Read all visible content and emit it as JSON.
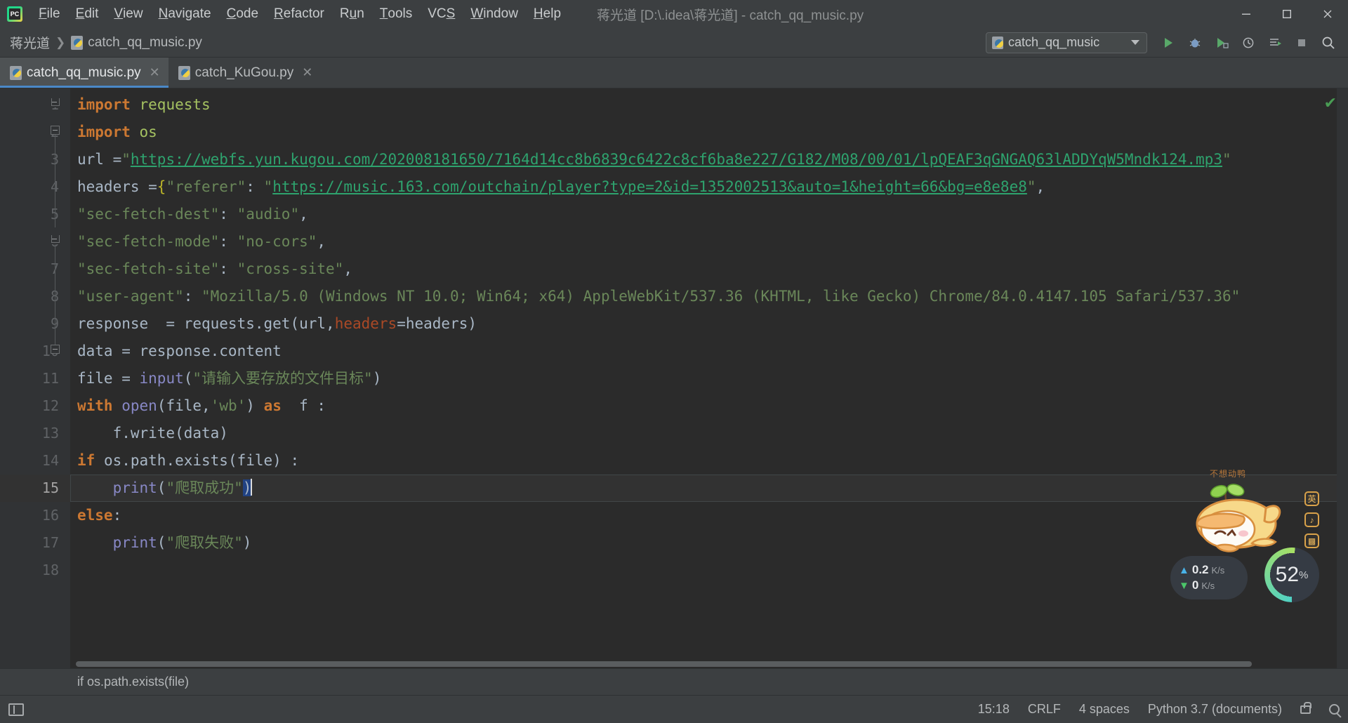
{
  "window": {
    "app_icon": "pycharm-logo-icon",
    "title": "蒋光道 [D:\\.idea\\蒋光道] - catch_qq_music.py",
    "controls": {
      "minimize": "−",
      "maximize": "▢",
      "close": "✕"
    }
  },
  "menubar": [
    {
      "label": "File",
      "mnemonic": "F"
    },
    {
      "label": "Edit",
      "mnemonic": "E"
    },
    {
      "label": "View",
      "mnemonic": "V"
    },
    {
      "label": "Navigate",
      "mnemonic": "N"
    },
    {
      "label": "Code",
      "mnemonic": "C"
    },
    {
      "label": "Refactor",
      "mnemonic": "R"
    },
    {
      "label": "Run",
      "mnemonic": "u"
    },
    {
      "label": "Tools",
      "mnemonic": "T"
    },
    {
      "label": "VCS",
      "mnemonic": "S"
    },
    {
      "label": "Window",
      "mnemonic": "W"
    },
    {
      "label": "Help",
      "mnemonic": "H"
    }
  ],
  "breadcrumb": {
    "project": "蒋光道",
    "separator": "❯",
    "file": "catch_qq_music.py"
  },
  "toolbar": {
    "run_config": "catch_qq_music",
    "buttons": [
      {
        "name": "run-button",
        "glyph": "▶"
      },
      {
        "name": "debug-button",
        "glyph": "🐞"
      },
      {
        "name": "run-coverage-button",
        "glyph": "▶"
      },
      {
        "name": "profile-button",
        "glyph": "◷"
      },
      {
        "name": "run-with-console-button",
        "glyph": "≡"
      },
      {
        "name": "stop-button",
        "glyph": "■"
      },
      {
        "name": "search-everywhere-button",
        "glyph": "🔍"
      }
    ]
  },
  "tabs": [
    {
      "label": "catch_qq_music.py",
      "active": true,
      "close": "✕"
    },
    {
      "label": "catch_KuGou.py",
      "active": false,
      "close": "✕"
    }
  ],
  "editor": {
    "current_line": 15,
    "line_count": 18,
    "inspection_status": "✔",
    "lines": [
      {
        "n": 1,
        "tokens": [
          {
            "t": "kw",
            "v": "import"
          },
          {
            "t": "id",
            "v": " "
          },
          {
            "t": "mod",
            "v": "requests"
          }
        ]
      },
      {
        "n": 2,
        "tokens": [
          {
            "t": "kw",
            "v": "import"
          },
          {
            "t": "id",
            "v": " "
          },
          {
            "t": "mod",
            "v": "os"
          }
        ]
      },
      {
        "n": 3,
        "tokens": [
          {
            "t": "id",
            "v": "url ="
          },
          {
            "t": "str",
            "v": "\""
          },
          {
            "t": "strg",
            "v": "https://webfs.yun.kugou.com/202008181650/7164d14cc8b6839c6422c8cf6ba8e227/G182/M08/00/01/lpQEAF3qGNGAQ63lADDYqW5Mndk124.mp3"
          },
          {
            "t": "str",
            "v": "\""
          }
        ]
      },
      {
        "n": 4,
        "tokens": [
          {
            "t": "id",
            "v": "headers ="
          },
          {
            "t": "brace",
            "v": "{"
          },
          {
            "t": "str",
            "v": "\"referer\""
          },
          {
            "t": "punc",
            "v": ": "
          },
          {
            "t": "str",
            "v": "\""
          },
          {
            "t": "strg",
            "v": "https://music.163.com/outchain/player?type=2&id=1352002513&auto=1&height=66&bg=e8e8e8"
          },
          {
            "t": "str",
            "v": "\""
          },
          {
            "t": "punc",
            "v": ","
          }
        ]
      },
      {
        "n": 5,
        "tokens": [
          {
            "t": "str",
            "v": "\"sec-fetch-dest\""
          },
          {
            "t": "punc",
            "v": ": "
          },
          {
            "t": "str",
            "v": "\"audio\""
          },
          {
            "t": "punc",
            "v": ","
          }
        ]
      },
      {
        "n": 6,
        "tokens": [
          {
            "t": "str",
            "v": "\"sec-fetch-mode\""
          },
          {
            "t": "punc",
            "v": ": "
          },
          {
            "t": "str",
            "v": "\"no-cors\""
          },
          {
            "t": "punc",
            "v": ","
          }
        ]
      },
      {
        "n": 7,
        "tokens": [
          {
            "t": "str",
            "v": "\"sec-fetch-site\""
          },
          {
            "t": "punc",
            "v": ": "
          },
          {
            "t": "str",
            "v": "\"cross-site\""
          },
          {
            "t": "punc",
            "v": ","
          }
        ]
      },
      {
        "n": 8,
        "tokens": [
          {
            "t": "str",
            "v": "\"user-agent\""
          },
          {
            "t": "punc",
            "v": ": "
          },
          {
            "t": "str",
            "v": "\"Mozilla/5.0 (Windows NT 10.0; Win64; x64) AppleWebKit/537.36 (KHTML, like Gecko) Chrome/84.0.4147.105 Safari/537.36\""
          }
        ]
      },
      {
        "n": 9,
        "tokens": [
          {
            "t": "id",
            "v": "response  = requests."
          },
          {
            "t": "id",
            "v": "get"
          },
          {
            "t": "punc",
            "v": "("
          },
          {
            "t": "id",
            "v": "url,"
          },
          {
            "t": "kwarg",
            "v": "headers"
          },
          {
            "t": "punc",
            "v": "="
          },
          {
            "t": "id",
            "v": "headers)"
          }
        ]
      },
      {
        "n": 10,
        "tokens": [
          {
            "t": "id",
            "v": "data = response.content"
          }
        ]
      },
      {
        "n": 11,
        "tokens": [
          {
            "t": "id",
            "v": "file = "
          },
          {
            "t": "builtin",
            "v": "input"
          },
          {
            "t": "punc",
            "v": "("
          },
          {
            "t": "str",
            "v": "\"请输入要存放的文件目标\""
          },
          {
            "t": "punc",
            "v": ")"
          }
        ]
      },
      {
        "n": 12,
        "tokens": [
          {
            "t": "kw",
            "v": "with"
          },
          {
            "t": "id",
            "v": " "
          },
          {
            "t": "builtin",
            "v": "open"
          },
          {
            "t": "punc",
            "v": "("
          },
          {
            "t": "id",
            "v": "file,"
          },
          {
            "t": "str",
            "v": "'wb'"
          },
          {
            "t": "punc",
            "v": ") "
          },
          {
            "t": "kw",
            "v": "as"
          },
          {
            "t": "id",
            "v": "  f :"
          }
        ]
      },
      {
        "n": 13,
        "tokens": [
          {
            "t": "id",
            "v": "    f.write(data)"
          }
        ]
      },
      {
        "n": 14,
        "tokens": [
          {
            "t": "kw",
            "v": "if"
          },
          {
            "t": "id",
            "v": " os.path.exists(file) :"
          }
        ]
      },
      {
        "n": 15,
        "tokens": [
          {
            "t": "id",
            "v": "    "
          },
          {
            "t": "builtin",
            "v": "print"
          },
          {
            "t": "punc",
            "v": "("
          },
          {
            "t": "str",
            "v": "\"爬取成功\""
          },
          {
            "t": "selpunc",
            "v": ")"
          }
        ]
      },
      {
        "n": 16,
        "tokens": [
          {
            "t": "kw",
            "v": "else"
          },
          {
            "t": "punc",
            "v": ":"
          }
        ]
      },
      {
        "n": 17,
        "tokens": [
          {
            "t": "id",
            "v": "    "
          },
          {
            "t": "builtin",
            "v": "print"
          },
          {
            "t": "punc",
            "v": "("
          },
          {
            "t": "str",
            "v": "\"爬取失败\""
          },
          {
            "t": "punc",
            "v": ")"
          }
        ]
      },
      {
        "n": 18,
        "tokens": []
      }
    ],
    "footer_breadcrumb": "if os.path.exists(file)"
  },
  "float_widget": {
    "cat_label": "不想动鸭",
    "side_icons": [
      "英",
      "♪",
      "▩"
    ],
    "upload_value": "0.2",
    "upload_unit": "K/s",
    "download_value": "0",
    "download_unit": "K/s",
    "gauge_value": "52",
    "gauge_unit": "%"
  },
  "statusbar": {
    "left_icon": "project-toggle-icon",
    "caret_position": "15:18",
    "line_separator": "CRLF",
    "indent": "4 spaces",
    "interpreter": "Python 3.7 (documents)",
    "lock_icon": "lock-icon",
    "search_icon": "magnifier-icon"
  },
  "colors": {
    "chrome_bg": "#3c3f41",
    "editor_bg": "#2b2b2b",
    "gutter_bg": "#313335",
    "tab_active": "#4e5254",
    "tab_underline": "#4a88c7",
    "keyword": "#cc7832",
    "string": "#6a8759",
    "string_url": "#2ea36e",
    "builtin": "#8888c6",
    "number": "#6897bb",
    "module": "#a5c261",
    "ok_green": "#499c54"
  }
}
